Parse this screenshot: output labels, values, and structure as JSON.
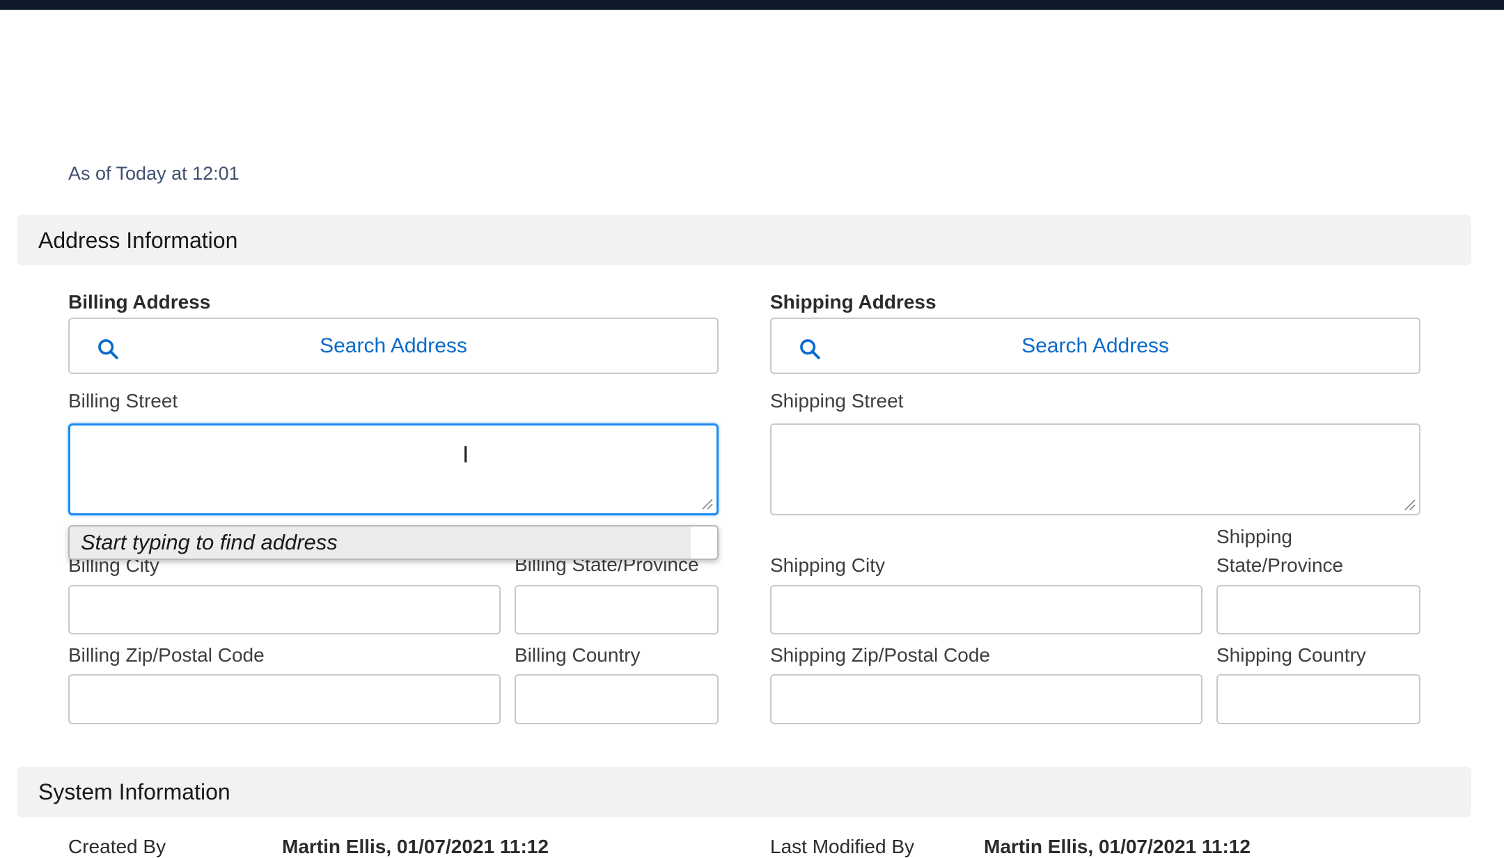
{
  "as_of": "As of Today at 12:01",
  "sections": {
    "address": "Address Information",
    "system": "System Information"
  },
  "billing": {
    "title": "Billing Address",
    "search": "Search Address",
    "street": "Billing Street",
    "city": "Billing City",
    "state": "Billing State/Province",
    "zip": "Billing Zip/Postal Code",
    "country": "Billing Country"
  },
  "shipping": {
    "title": "Shipping Address",
    "search": "Search Address",
    "street": "Shipping Street",
    "city": "Shipping City",
    "state_line1": "Shipping",
    "state_line2": "State/Province",
    "zip": "Shipping Zip/Postal Code",
    "country": "Shipping Country"
  },
  "autocomplete": "Start typing to find address",
  "system": {
    "created_label": "Created By",
    "created_value": "Martin Ellis, 01/07/2021 11:12",
    "modified_label": "Last Modified By",
    "modified_value": "Martin Ellis, 01/07/2021 11:12"
  }
}
